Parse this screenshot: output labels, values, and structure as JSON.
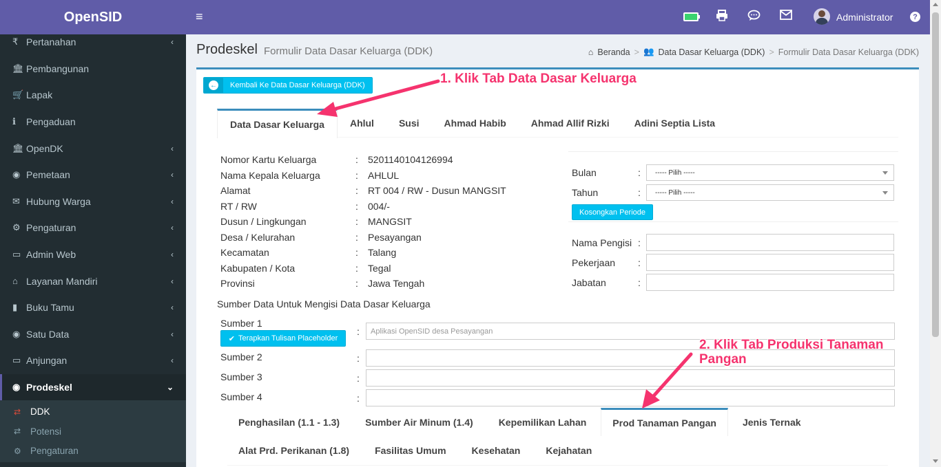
{
  "app": {
    "brand": "OpenSID"
  },
  "sidebar": {
    "items": [
      {
        "label": "Pertanahan",
        "icon": "flag-icon",
        "glyph": "₹",
        "caret": true
      },
      {
        "label": "Pembangunan",
        "icon": "bank-icon",
        "glyph": "🏛",
        "caret": false
      },
      {
        "label": "Lapak",
        "icon": "cart-icon",
        "glyph": "🛒",
        "caret": false
      },
      {
        "label": "Pengaduan",
        "icon": "info-icon",
        "glyph": "ℹ",
        "caret": false
      },
      {
        "label": "OpenDK",
        "icon": "bank-icon",
        "glyph": "🏛",
        "caret": true
      },
      {
        "label": "Pemetaan",
        "icon": "globe-icon",
        "glyph": "◉",
        "caret": true
      },
      {
        "label": "Hubung Warga",
        "icon": "envelope-icon",
        "glyph": "✉",
        "caret": true
      },
      {
        "label": "Pengaturan",
        "icon": "users-icon",
        "glyph": "⚙",
        "caret": true
      },
      {
        "label": "Admin Web",
        "icon": "desktop-icon",
        "glyph": "▭",
        "caret": true
      },
      {
        "label": "Layanan Mandiri",
        "icon": "inbox-icon",
        "glyph": "⌂",
        "caret": true
      },
      {
        "label": "Buku Tamu",
        "icon": "book-icon",
        "glyph": "▮",
        "caret": true
      },
      {
        "label": "Satu Data",
        "icon": "globe-icon",
        "glyph": "◉",
        "caret": true
      },
      {
        "label": "Anjungan",
        "icon": "desktop-icon",
        "glyph": "▭",
        "caret": true
      },
      {
        "label": "Prodeskel",
        "icon": "globe-icon",
        "glyph": "◉",
        "caret": true,
        "active": true
      }
    ],
    "submenu": [
      {
        "label": "DDK",
        "glyph": "⇄",
        "active": true
      },
      {
        "label": "Potensi",
        "glyph": "⇄",
        "active": false
      },
      {
        "label": "Pengaturan",
        "glyph": "⚙",
        "active": false
      }
    ]
  },
  "topbar": {
    "hamburger": "≡",
    "user": "Administrator",
    "help": "?"
  },
  "header": {
    "title": "Prodeskel",
    "subtitle": "Formulir Data Dasar Keluarga (DDK)",
    "breadcrumb": [
      "Beranda",
      "Data Dasar Keluarga (DDK)",
      "Formulir Data Dasar Keluarga (DDK)"
    ]
  },
  "buttons": {
    "back": "Kembali Ke Data Dasar Keluarga (DDK)",
    "kosongkan": "Kosongkan Periode",
    "terapkan": "Terapkan Tulisan Placeholder"
  },
  "tabs": [
    "Data Dasar Keluarga",
    "Ahlul",
    "Susi",
    "Ahmad Habib",
    "Ahmad Allif Rizki",
    "Adini Septia Lista"
  ],
  "info": [
    {
      "label": "Nomor Kartu Keluarga",
      "value": "5201140104126994"
    },
    {
      "label": "Nama Kepala Keluarga",
      "value": "AHLUL"
    },
    {
      "label": "Alamat",
      "value": "RT 004 / RW - Dusun MANGSIT"
    },
    {
      "label": "RT / RW",
      "value": "004/-"
    },
    {
      "label": "Dusun / Lingkungan",
      "value": "MANGSIT"
    },
    {
      "label": "Desa / Kelurahan",
      "value": "Pesayangan"
    },
    {
      "label": "Kecamatan",
      "value": "Talang"
    },
    {
      "label": "Kabupaten / Kota",
      "value": "Tegal"
    },
    {
      "label": "Provinsi",
      "value": "Jawa Tengah"
    }
  ],
  "periode": {
    "bulan_label": "Bulan",
    "bulan_value": "----- Pilih -----",
    "tahun_label": "Tahun",
    "tahun_value": "----- Pilih -----"
  },
  "pengisi": {
    "nama_label": "Nama Pengisi",
    "pekerjaan_label": "Pekerjaan",
    "jabatan_label": "Jabatan"
  },
  "sumber": {
    "title": "Sumber Data Untuk Mengisi Data Dasar Keluarga",
    "rows": [
      {
        "label": "Sumber 1",
        "placeholder": "Aplikasi OpenSID desa Pesayangan"
      },
      {
        "label": "Sumber 2",
        "placeholder": ""
      },
      {
        "label": "Sumber 3",
        "placeholder": ""
      },
      {
        "label": "Sumber 4",
        "placeholder": ""
      }
    ]
  },
  "bottom_tabs": {
    "row1": [
      "Penghasilan (1.1 - 1.3)",
      "Sumber Air Minum (1.4)",
      "Kepemilikan Lahan",
      "Prod Tanaman Pangan",
      "Jenis Ternak"
    ],
    "row2": [
      "Alat Prd. Perikanan (1.8)",
      "Fasilitas Umum",
      "Kesehatan",
      "Kejahatan"
    ],
    "active": "Prod Tanaman Pangan"
  },
  "annotations": {
    "step1": "1. Klik Tab Data Dasar Keluarga",
    "step2_line1": "2. Klik Tab Produksi Tanaman",
    "step2_line2": "Pangan",
    "color": "#f5336e"
  }
}
